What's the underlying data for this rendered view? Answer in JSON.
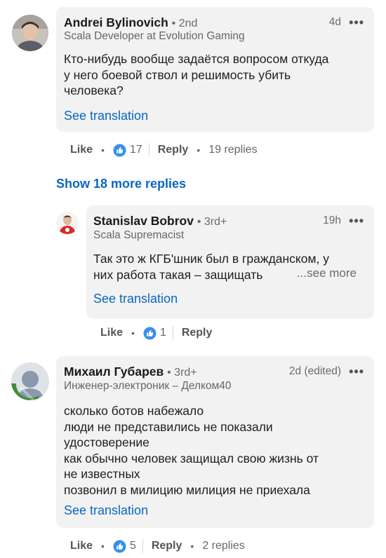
{
  "comments": [
    {
      "author": "Andrei Bylinovich",
      "degree": "• 2nd",
      "headline": "Scala Developer at Evolution Gaming",
      "time": "4d",
      "more_icon": "more-horizontal-icon",
      "text_lines": [
        "Кто-нибудь вообще задаётся вопросом откуда",
        "у него боевой ствол и решимость убить",
        "человека?"
      ],
      "translate_label": "See translation",
      "like_label": "Like",
      "like_count": "17",
      "reply_label": "Reply",
      "replies_label": "19 replies"
    },
    {
      "author": "Stanislav Bobrov",
      "degree": "• 3rd+",
      "headline": "Scala Supremacist",
      "time": "19h",
      "more_icon": "more-horizontal-icon",
      "text_lines": [
        "Так это ж КГБ'шник был в гражданском, у",
        "них работа такая – защищать"
      ],
      "see_more_label": "...see more",
      "translate_label": "See translation",
      "like_label": "Like",
      "like_count": "1",
      "reply_label": "Reply"
    },
    {
      "author": "Михаил Губарев",
      "degree": "• 3rd+",
      "headline": "Инженер-электроник – Делком40",
      "time": "2d (edited)",
      "more_icon": "more-horizontal-icon",
      "avatar_badge": "#OPENTOWORK",
      "text_lines": [
        "сколько ботов набежало",
        "люди не представились не показали",
        "удостоверение",
        "как обычно человек защищал свою жизнь от",
        "не известных",
        "позвонил в милицию милиция не приехала"
      ],
      "translate_label": "See translation",
      "like_label": "Like",
      "like_count": "5",
      "reply_label": "Reply",
      "replies_label": "2 replies"
    }
  ],
  "show_more_replies": "Show 18 more replies",
  "colors": {
    "link": "#0a66c2",
    "bubble": "#f2f2f2",
    "opentowork": "#3f8f3a"
  }
}
